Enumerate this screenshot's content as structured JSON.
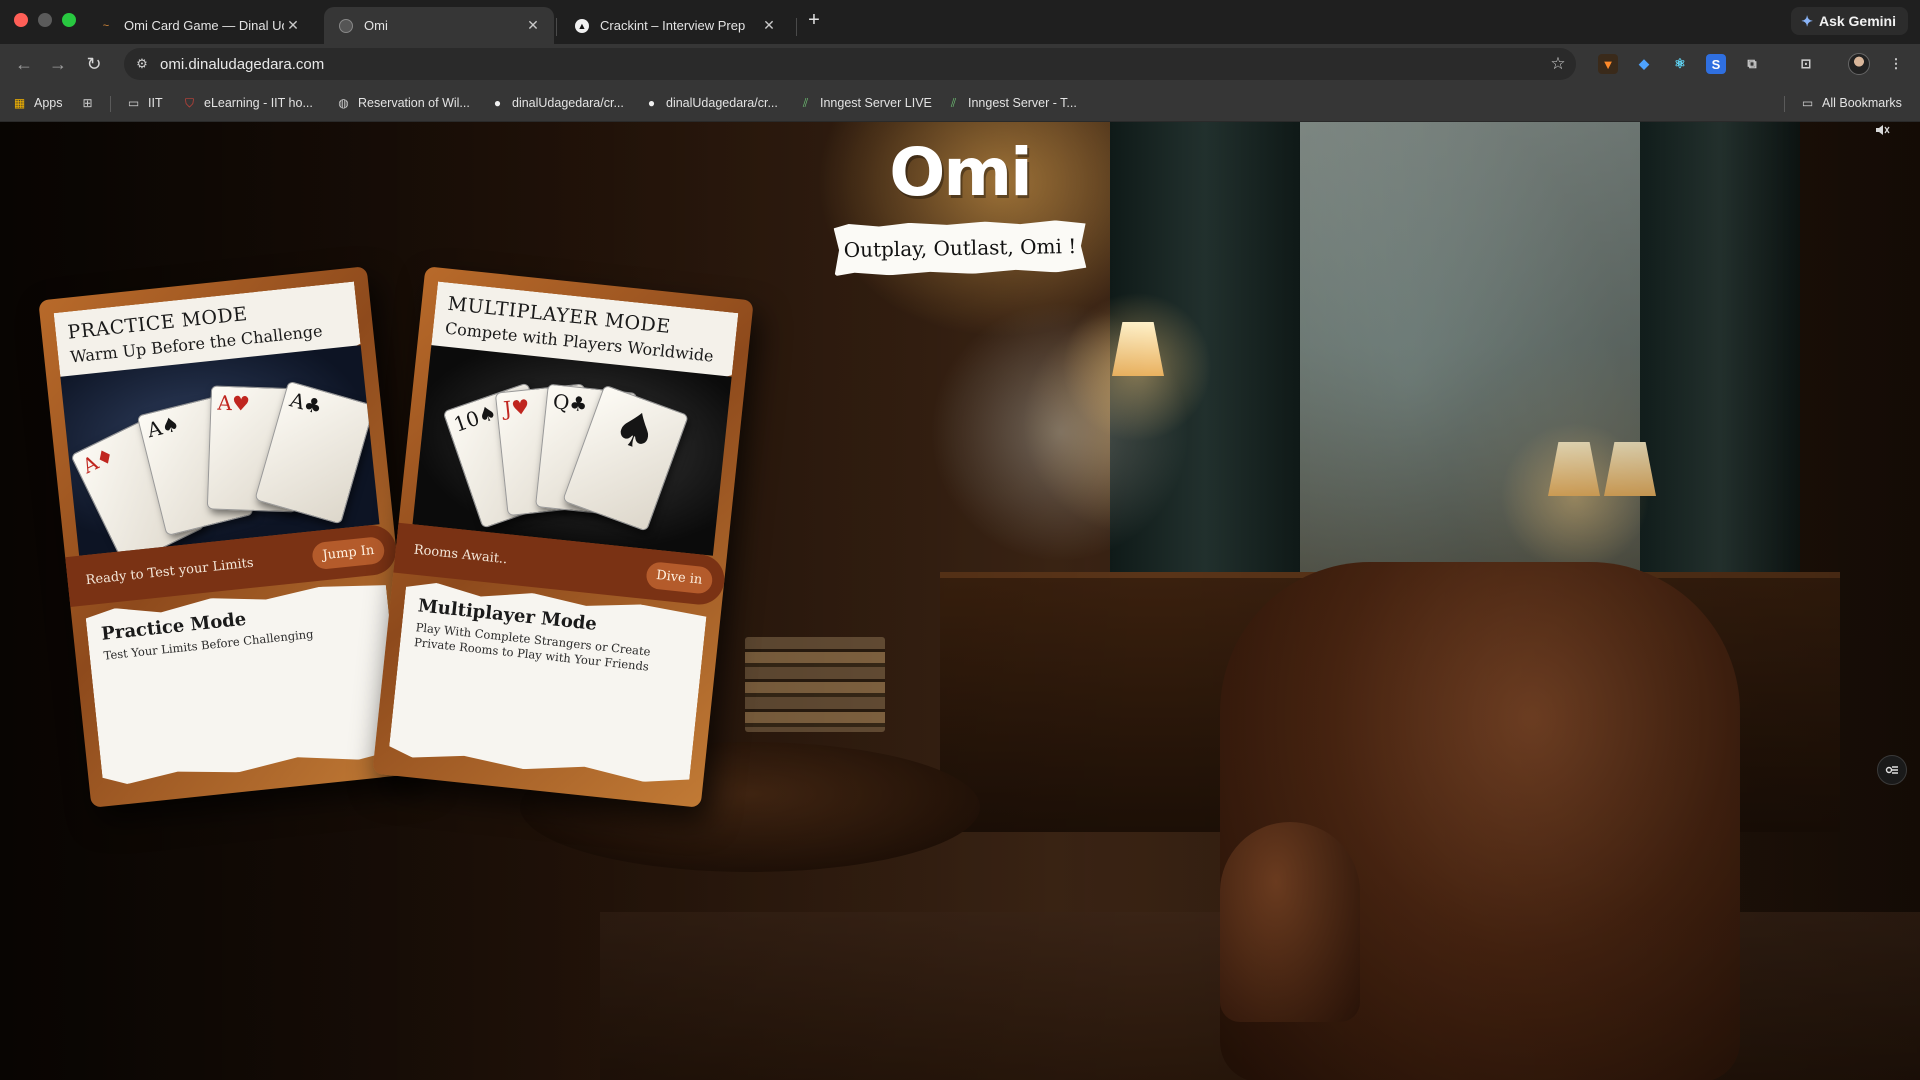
{
  "browser": {
    "tabs": [
      {
        "title": "Omi Card Game — Dinal Udag",
        "active": false
      },
      {
        "title": "Omi",
        "active": true
      },
      {
        "title": "Crackint – Interview Prep",
        "active": false
      }
    ],
    "new_tab_symbol": "+",
    "ask_gemini": "Ask Gemini",
    "url": "omi.dinaludagedara.com",
    "bookmarks": {
      "apps": "Apps",
      "items": [
        {
          "label": "IIT",
          "icon": "folder-icon"
        },
        {
          "label": "eLearning - IIT ho...",
          "icon": "shield-icon"
        },
        {
          "label": "Reservation of Wil...",
          "icon": "globe-icon"
        },
        {
          "label": "dinalUdagedara/cr...",
          "icon": "github-icon"
        },
        {
          "label": "dinalUdagedara/cr...",
          "icon": "github-icon"
        },
        {
          "label": "Inngest Server LIVE",
          "icon": "inngest-icon"
        },
        {
          "label": "Inngest Server - T...",
          "icon": "inngest-icon"
        }
      ],
      "all_bookmarks": "All Bookmarks"
    },
    "colors": {
      "chrome_dark": "#1f1f1f",
      "toolbar": "#363636",
      "gemini_spark": "#8ab4f8"
    }
  },
  "page": {
    "title": "Omi",
    "tagline": "Outplay, Outlast, Omi !",
    "cards": [
      {
        "heading": "PRACTICE MODE",
        "subheading": "Warm Up Before the Challenge",
        "strip_text": "Ready to Test your Limits",
        "button": "Jump In",
        "body_title": "Practice Mode",
        "body_desc": "Test Your Limits Before Challenging"
      },
      {
        "heading": "MULTIPLAYER MODE",
        "subheading": "Compete with Players Worldwide",
        "strip_text": "Rooms Await..",
        "button": "Dive in",
        "body_title": "Multiplayer Mode",
        "body_desc": "Play With Complete Strangers or Create Private Rooms to Play with Your Friends"
      }
    ],
    "colors": {
      "card_frame": "#b86a2a",
      "strip": "#7a3214",
      "button": "#b45b2b"
    }
  }
}
